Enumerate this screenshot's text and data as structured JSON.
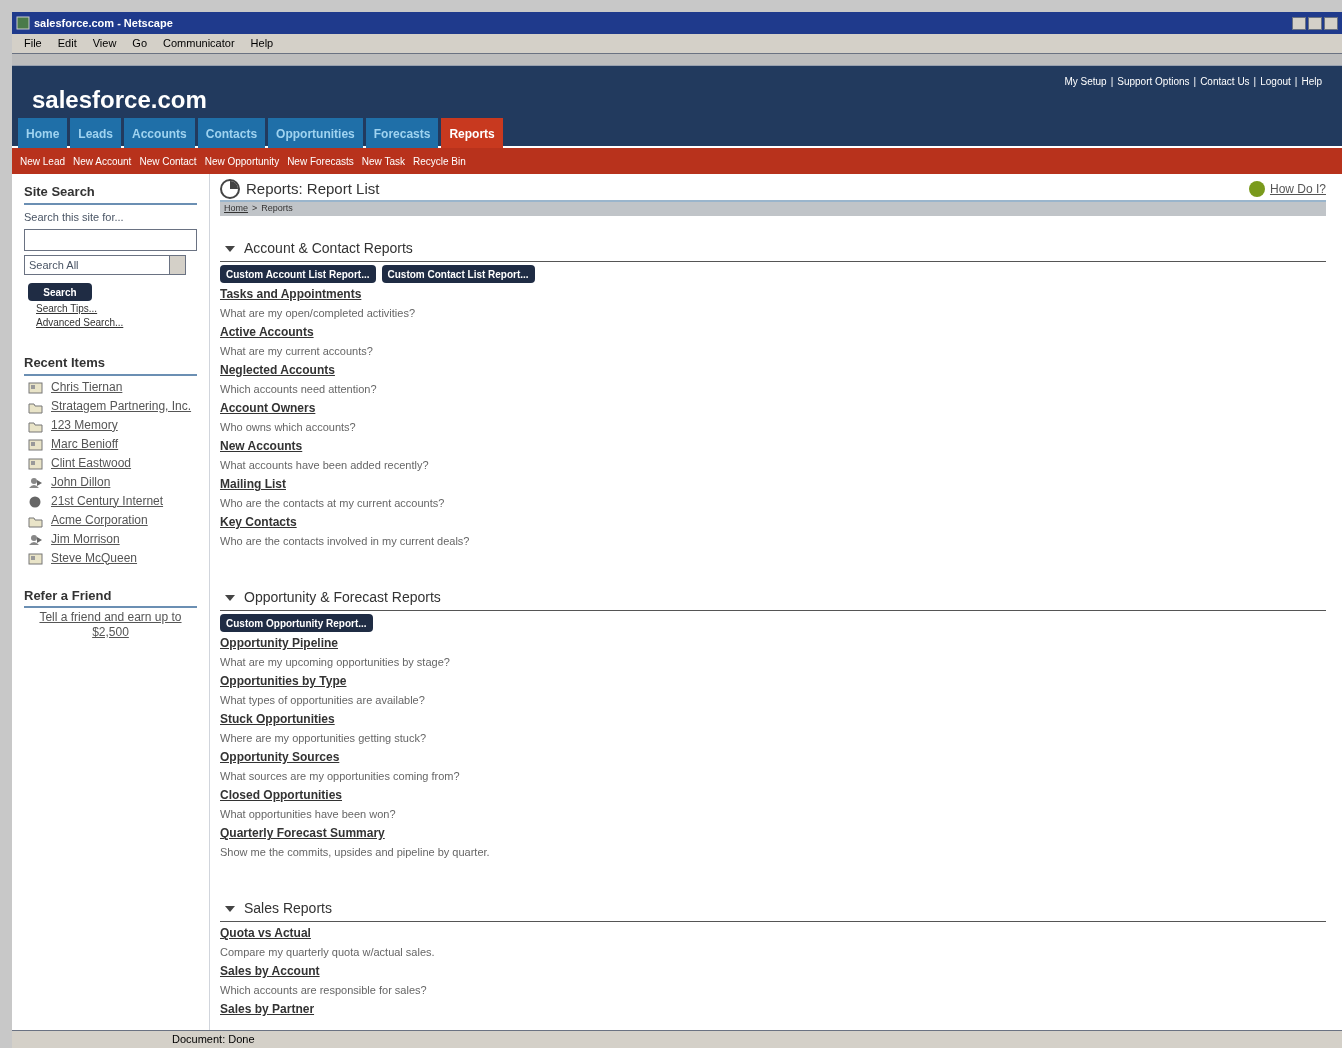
{
  "window": {
    "title": "salesforce.com - Netscape"
  },
  "menu": [
    "File",
    "Edit",
    "View",
    "Go",
    "Communicator",
    "Help"
  ],
  "header": {
    "logo": "salesforce.com",
    "links": [
      "My Setup",
      "Support Options",
      "Contact Us",
      "Logout",
      "Help"
    ],
    "separator": "|"
  },
  "tabs": [
    {
      "label": "Home",
      "selected": false
    },
    {
      "label": "Leads",
      "selected": false
    },
    {
      "label": "Accounts",
      "selected": false
    },
    {
      "label": "Contacts",
      "selected": false
    },
    {
      "label": "Opportunities",
      "selected": false
    },
    {
      "label": "Forecasts",
      "selected": false
    },
    {
      "label": "Reports",
      "selected": true
    }
  ],
  "quick_links": [
    "New Lead",
    "New Account",
    "New Contact",
    "New Opportunity",
    "New Forecasts",
    "New Task",
    "Recycle Bin"
  ],
  "sidebar": {
    "search": {
      "title": "Site Search",
      "prompt": "Search this site for...",
      "scope": "Search All",
      "button": "Search",
      "links": [
        "Search Tips...",
        "Advanced Search..."
      ]
    },
    "recent": {
      "title": "Recent Items",
      "items": [
        {
          "label": "Chris Tiernan",
          "kind": "contact"
        },
        {
          "label": "Stratagem Partnering, Inc.",
          "kind": "account"
        },
        {
          "label": "123 Memory",
          "kind": "account"
        },
        {
          "label": "Marc Benioff",
          "kind": "contact"
        },
        {
          "label": "Clint Eastwood",
          "kind": "contact"
        },
        {
          "label": "John Dillon",
          "kind": "lead"
        },
        {
          "label": "21st Century Internet",
          "kind": "globe"
        },
        {
          "label": "Acme Corporation",
          "kind": "account"
        },
        {
          "label": "Jim Morrison",
          "kind": "lead"
        },
        {
          "label": "Steve McQueen",
          "kind": "contact"
        }
      ]
    },
    "refer": {
      "title": "Refer a Friend",
      "link": "Tell a friend and earn up to $2,500"
    }
  },
  "page": {
    "title": "Reports: Report List",
    "help": "How Do I?",
    "breadcrumb": [
      "Home",
      "Reports"
    ],
    "breadcrumb_separator": ">",
    "sections": [
      {
        "title": "Account & Contact Reports",
        "buttons": [
          "Custom Account List Report...",
          "Custom Contact List Report..."
        ],
        "reports": [
          {
            "name": "Tasks and Appointments",
            "desc": "What are my open/completed activities?"
          },
          {
            "name": "Active Accounts",
            "desc": "What are my current accounts?"
          },
          {
            "name": "Neglected Accounts",
            "desc": "Which accounts need attention?"
          },
          {
            "name": "Account Owners",
            "desc": "Who owns which accounts?"
          },
          {
            "name": "New Accounts",
            "desc": "What accounts have been added recently?"
          },
          {
            "name": "Mailing List",
            "desc": "Who are the contacts at my current accounts?"
          },
          {
            "name": "Key Contacts",
            "desc": "Who are the contacts involved in my current deals?"
          }
        ]
      },
      {
        "title": "Opportunity & Forecast Reports",
        "buttons": [
          "Custom Opportunity Report..."
        ],
        "reports": [
          {
            "name": "Opportunity Pipeline",
            "desc": "What are my upcoming opportunities by stage?"
          },
          {
            "name": "Opportunities by Type",
            "desc": "What types of opportunities are available?"
          },
          {
            "name": "Stuck Opportunities",
            "desc": "Where are my opportunities getting stuck?"
          },
          {
            "name": "Opportunity Sources",
            "desc": "What sources are my opportunities coming from?"
          },
          {
            "name": "Closed Opportunities",
            "desc": "What opportunities have been won?"
          },
          {
            "name": "Quarterly Forecast Summary",
            "desc": "Show me the commits, upsides and pipeline by quarter."
          }
        ]
      },
      {
        "title": "Sales Reports",
        "reports": [
          {
            "name": "Quota vs Actual",
            "desc": "Compare my quarterly quota w/actual sales."
          },
          {
            "name": "Sales by Account",
            "desc": "Which accounts are responsible for sales?"
          },
          {
            "name": "Sales by Partner"
          }
        ]
      }
    ]
  },
  "status_bar": {
    "text": "Document: Done"
  }
}
